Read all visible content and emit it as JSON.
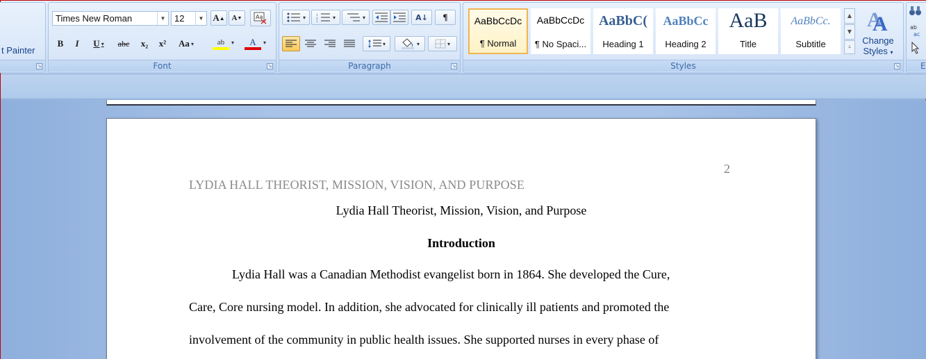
{
  "clipboard": {
    "format_painter_label": "t Painter"
  },
  "font": {
    "name": "Times New Roman",
    "size": "12",
    "group_label": "Font",
    "buttons": {
      "bold": "B",
      "italic": "I",
      "underline": "U",
      "strikethrough": "abc",
      "subscript": "x₂",
      "superscript": "x²",
      "change_case": "Aa",
      "grow": "A",
      "shrink": "A",
      "highlight": "ab",
      "font_color": "A"
    }
  },
  "paragraph": {
    "group_label": "Paragraph",
    "sort": "A↓",
    "show_marks": "¶"
  },
  "styles": {
    "group_label": "Styles",
    "items": [
      {
        "sample": "AaBbCcDc",
        "name": "¶ Normal"
      },
      {
        "sample": "AaBbCcDc",
        "name": "¶ No Spaci..."
      },
      {
        "sample": "AaBbC(",
        "name": "Heading 1"
      },
      {
        "sample": "AaBbCc",
        "name": "Heading 2"
      },
      {
        "sample": "AaB",
        "name": "Title"
      },
      {
        "sample": "AaBbCc.",
        "name": "Subtitle"
      }
    ],
    "change_styles_line1": "Change",
    "change_styles_line2": "Styles"
  },
  "editing": {
    "group_label": "E"
  },
  "colors": {
    "highlight": "#ffff00",
    "font_color": "#e00000",
    "selected_style": "#f0b451"
  },
  "document": {
    "page_number": "2",
    "running_head": "LYDIA HALL THEORIST, MISSION, VISION, AND PURPOSE",
    "title": "Lydia Hall Theorist, Mission,  Vision,  and Purpose",
    "heading": "Introduction",
    "body_lines": [
      "Lydia Hall was a Canadian Methodist evangelist born in 1864. She developed the Cure,",
      "Care, Core nursing model. In addition, she advocated for clinically ill patients and promoted the",
      "involvement of the community in public health issues.  She supported nurses in every phase of"
    ]
  }
}
